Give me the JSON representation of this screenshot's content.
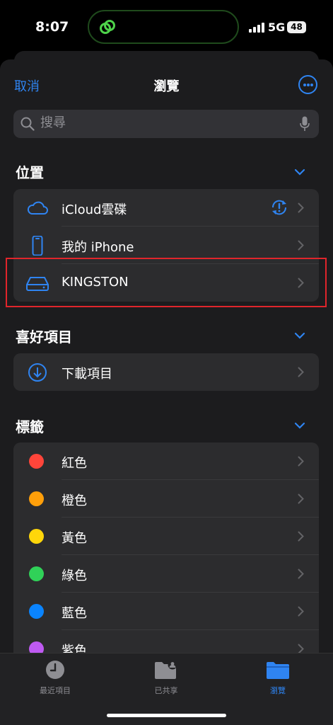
{
  "status": {
    "time": "8:07",
    "network": "5G",
    "battery": "48"
  },
  "nav": {
    "cancel": "取消",
    "title": "瀏覽"
  },
  "search": {
    "placeholder": "搜尋"
  },
  "sections": {
    "locations": {
      "title": "位置",
      "items": [
        {
          "label": "iCloud雲碟",
          "icon": "cloud-icon"
        },
        {
          "label": "我的 iPhone",
          "icon": "phone-icon"
        },
        {
          "label": "KINGSTON",
          "icon": "drive-icon"
        }
      ]
    },
    "favorites": {
      "title": "喜好項目",
      "items": [
        {
          "label": "下載項目",
          "icon": "download-icon"
        }
      ]
    },
    "tags": {
      "title": "標籤",
      "items": [
        {
          "label": "紅色",
          "color": "#ff453a"
        },
        {
          "label": "橙色",
          "color": "#ff9f0a"
        },
        {
          "label": "黃色",
          "color": "#ffd60a"
        },
        {
          "label": "綠色",
          "color": "#30d158"
        },
        {
          "label": "藍色",
          "color": "#0a84ff"
        },
        {
          "label": "紫色",
          "color": "#bf5af2"
        }
      ]
    }
  },
  "tabbar": {
    "recent": "最近項目",
    "shared": "已共享",
    "browse": "瀏覽"
  },
  "colors": {
    "accent": "#2f84f1",
    "highlight": "#e0252b"
  }
}
